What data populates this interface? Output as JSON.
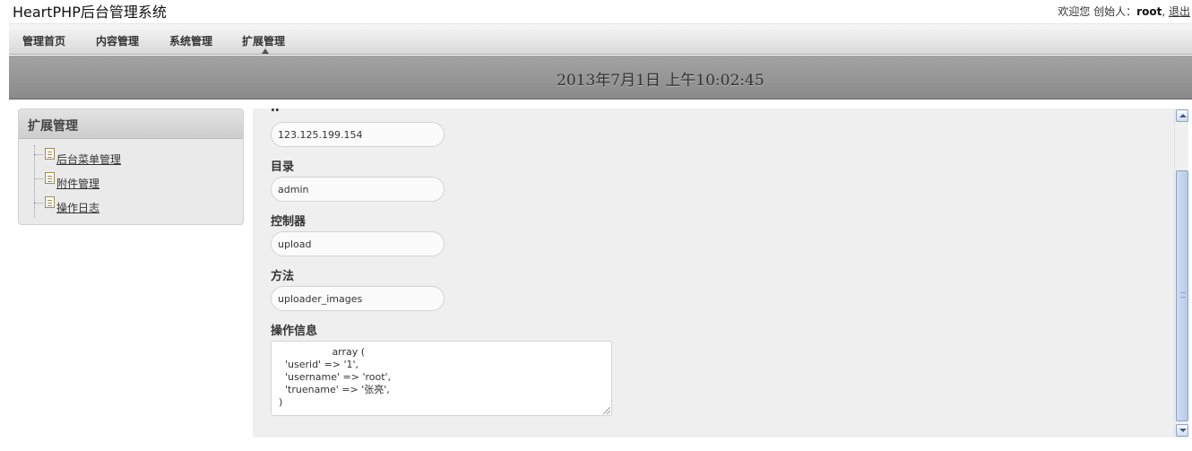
{
  "app": {
    "title": "HeartPHP后台管理系统"
  },
  "userbar": {
    "welcome": "欢迎您 创始人：",
    "username": "root",
    "sep": ",",
    "logout": "退出"
  },
  "nav": {
    "items": [
      {
        "label": "管理首页"
      },
      {
        "label": "内容管理"
      },
      {
        "label": "系统管理"
      },
      {
        "label": "扩展管理",
        "active": true
      }
    ]
  },
  "clock": "2013年7月1日 上午10:02:45",
  "sidebar": {
    "title": "扩展管理",
    "items": [
      {
        "label": "后台菜单管理",
        "icon": "doc-icon"
      },
      {
        "label": "附件管理",
        "icon": "doc-icon"
      },
      {
        "label": "操作日志",
        "icon": "doc-icon"
      }
    ]
  },
  "form": {
    "ip_label": "IP",
    "ip_value": "123.125.199.154",
    "dir_label": "目录",
    "dir_value": "admin",
    "controller_label": "控制器",
    "controller_value": "upload",
    "method_label": "方法",
    "method_value": "uploader_images",
    "info_label": "操作信息",
    "info_value": "                 array (\n  'userid' => '1',\n  'username' => 'root',\n  'truename' => '张亮',\n)"
  },
  "colors": {
    "nav_band": "#d9d9d9",
    "date_band": "#959595",
    "panel": "#efefef",
    "scroll_thumb": "#c3d4ee"
  }
}
